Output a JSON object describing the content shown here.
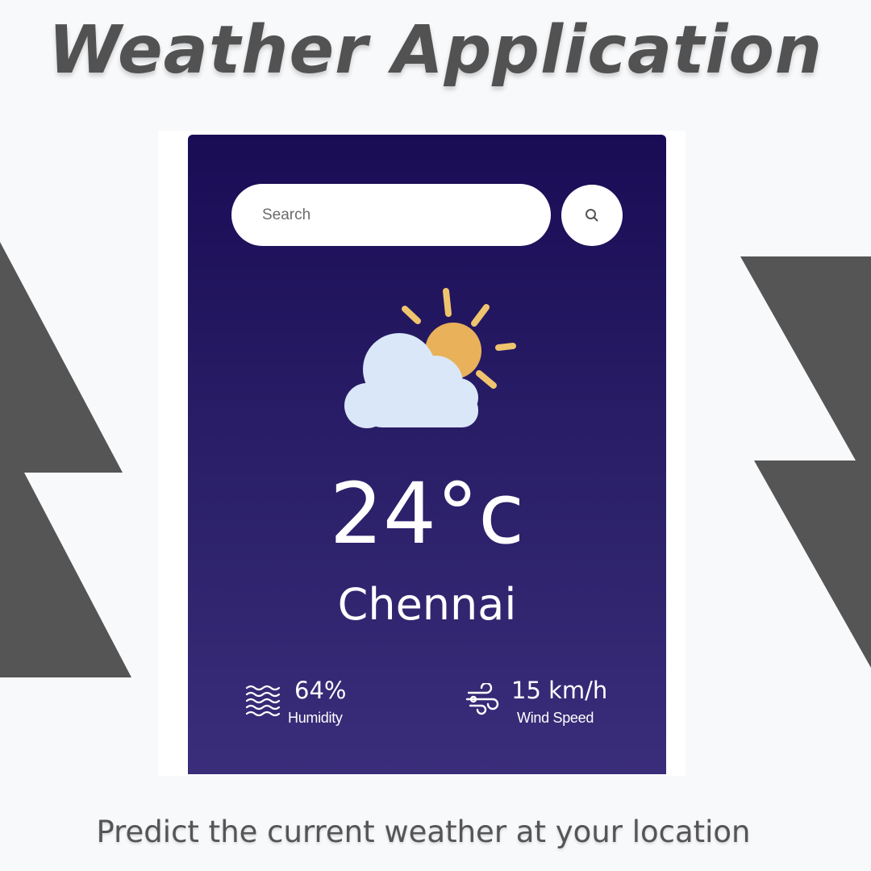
{
  "header": {
    "title": "Weather Application"
  },
  "search": {
    "placeholder": "Search",
    "button_icon": "search-icon"
  },
  "weather": {
    "icon": "partly-cloudy-icon",
    "temperature": "24°c",
    "city": "Chennai",
    "humidity": {
      "icon": "humidity-icon",
      "value": "64%",
      "label": "Humidity"
    },
    "wind": {
      "icon": "wind-icon",
      "value": "15 km/h",
      "label": "Wind Speed"
    }
  },
  "footer": {
    "tagline": "Predict the current weather at your location"
  },
  "colors": {
    "page_background": "#f8f9fb",
    "card_gradient_top": "#1a0b55",
    "card_gradient_bottom": "#3a2d7a",
    "bolt_gray": "#555555",
    "sun": "#e8b15a",
    "sun_rays": "#efc46e",
    "cloud": "#d9e7f8",
    "text_light": "#ffffff",
    "title_gray": "#525252"
  }
}
